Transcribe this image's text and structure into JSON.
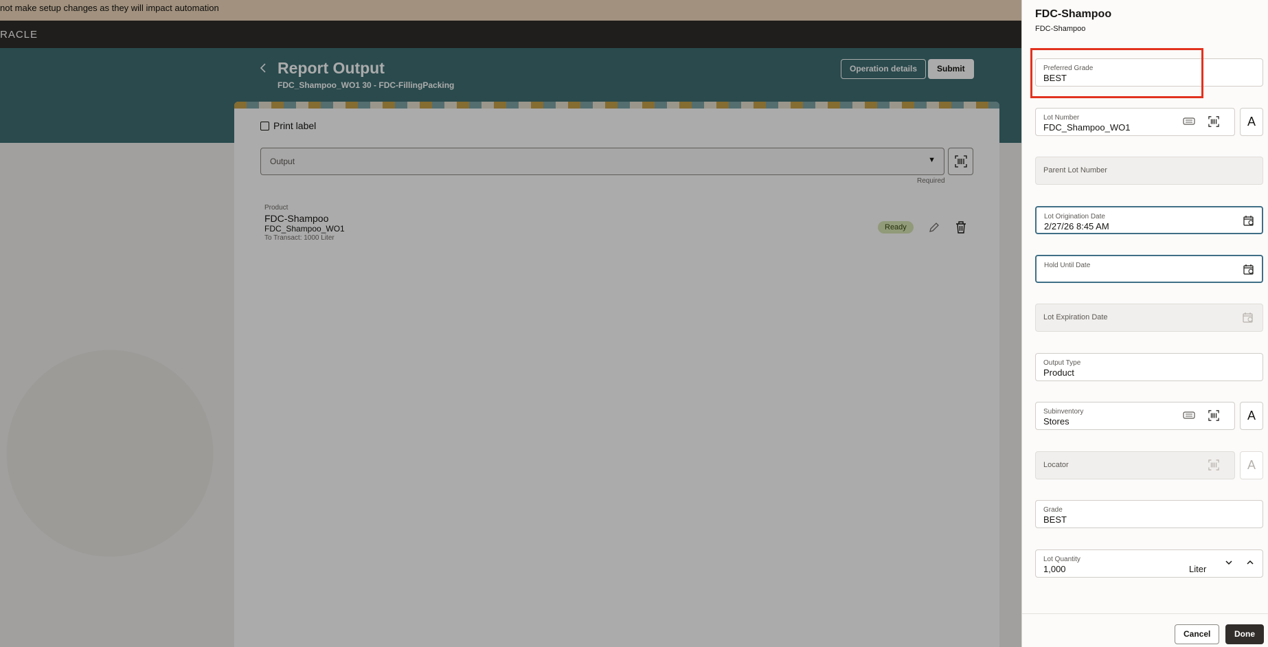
{
  "banner": {
    "text": "not make setup changes as they will impact automation"
  },
  "app": {
    "logo": "RACLE"
  },
  "header": {
    "back_icon": "chevron-left-icon",
    "title": "Report Output",
    "subtitle": "FDC_Shampoo_WO1 30 - FDC-FillingPacking",
    "operation_details_label": "Operation details",
    "submit_label": "Submit"
  },
  "main": {
    "print_label": "Print label",
    "output_label": "Output",
    "required_text": "Required",
    "product": {
      "caption": "Product",
      "name": "FDC-Shampoo",
      "lot": "FDC_Shampoo_WO1",
      "to_transact": "To Transact: 1000 Liter",
      "status": "Ready"
    }
  },
  "drawer": {
    "title": "FDC-Shampoo",
    "subtitle": "FDC-Shampoo",
    "fields": {
      "preferred_grade": {
        "label": "Preferred Grade",
        "value": "BEST"
      },
      "lot_number": {
        "label": "Lot Number",
        "value": "FDC_Shampoo_WO1"
      },
      "parent_lot_number": {
        "label": "Parent Lot Number"
      },
      "lot_origination_date": {
        "label": "Lot Origination Date",
        "value": "2/27/26 8:45 AM"
      },
      "hold_until_date": {
        "label": "Hold Until Date",
        "value": ""
      },
      "lot_expiration_date": {
        "label": "Lot Expiration Date"
      },
      "output_type": {
        "label": "Output Type",
        "value": "Product"
      },
      "subinventory": {
        "label": "Subinventory",
        "value": "Stores"
      },
      "locator": {
        "label": "Locator"
      },
      "grade": {
        "label": "Grade",
        "value": "BEST"
      },
      "lot_quantity": {
        "label": "Lot Quantity",
        "value": "1,000",
        "unit": "Liter"
      }
    },
    "cancel_label": "Cancel",
    "done_label": "Done"
  },
  "colors": {
    "highlight": "#e2321e",
    "hero": "#3f6f73",
    "topbar": "#312d2a",
    "banner": "#f0d9bd"
  }
}
